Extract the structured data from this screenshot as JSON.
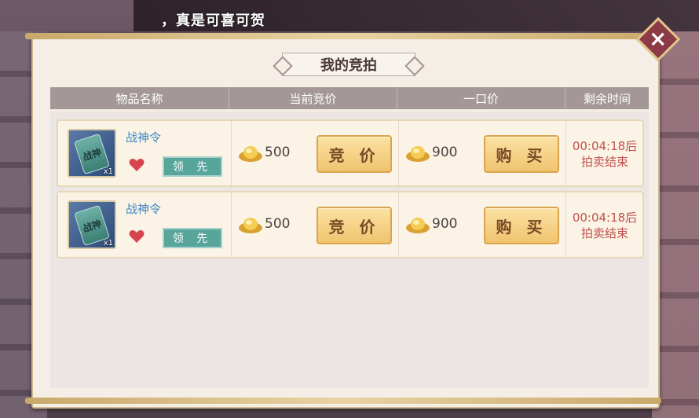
{
  "chat": {
    "message": "，真是可喜可贺"
  },
  "panel": {
    "title": "我的竞拍",
    "close_label": "×"
  },
  "table": {
    "headers": [
      "物品名称",
      "当前竞价",
      "一口价",
      "剩余时间"
    ]
  },
  "rows": [
    {
      "item_name": "战神令",
      "item_icon_text": "战神",
      "quantity": "x1",
      "status_badge": "领 先",
      "current_bid": "500",
      "bid_button": "竞 价",
      "buyout_price": "900",
      "buy_button": "购 买",
      "time_left": "00:04:18后",
      "time_suffix": "拍卖结束"
    },
    {
      "item_name": "战神令",
      "item_icon_text": "战神",
      "quantity": "x1",
      "status_badge": "领 先",
      "current_bid": "500",
      "bid_button": "竞 价",
      "buyout_price": "900",
      "buy_button": "购 买",
      "time_left": "00:04:18后",
      "time_suffix": "拍卖结束"
    }
  ],
  "colors": {
    "accent_gold": "#f0c36e",
    "lead_green": "#57a59b",
    "time_red": "#c0504d",
    "item_blue": "#3f87c2"
  },
  "icons": [
    "close-icon",
    "heart-icon",
    "gold-ingot-icon",
    "war-token-icon"
  ]
}
